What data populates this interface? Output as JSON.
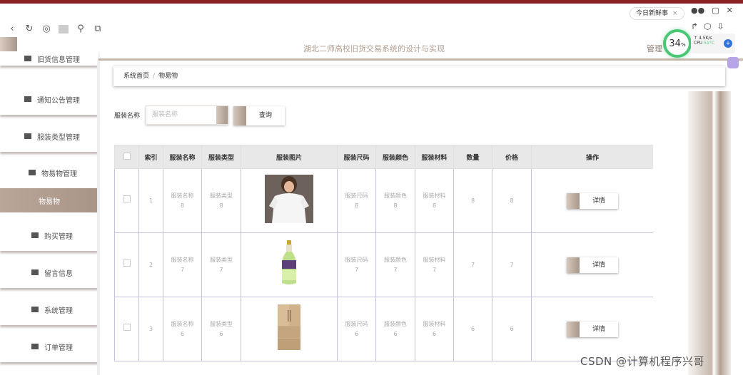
{
  "browser": {
    "tab_label": "今日新鲜事",
    "tab_close": "×",
    "window_controls": [
      "▢",
      "✕"
    ]
  },
  "cpu": {
    "percent": "34",
    "percent_unit": "%",
    "speed": "4.5K/s",
    "cpu_label": "CPU",
    "cpu_temp": "51°C"
  },
  "header": {
    "site_title": "湖北二师高校旧货交易系统的设计与实现",
    "admin_label": "管理"
  },
  "sidebar": {
    "items": [
      {
        "label": "旧货信息管理"
      },
      {
        "label": "通知公告管理"
      },
      {
        "label": "服装类型管理"
      },
      {
        "label": "物易物管理"
      },
      {
        "label": "物易物"
      },
      {
        "label": "购买管理"
      },
      {
        "label": "留言信息"
      },
      {
        "label": "系统管理"
      },
      {
        "label": "订单管理"
      }
    ]
  },
  "breadcrumb": {
    "home": "系统首页",
    "separator": "/",
    "current": "物易物"
  },
  "search": {
    "label": "服装名称",
    "placeholder": "服装名称",
    "button": "查询"
  },
  "table": {
    "headers": [
      "",
      "索引",
      "服装名称",
      "服装类型",
      "服装图片",
      "服装尺码",
      "服装颜色",
      "服装材料",
      "数量",
      "价格",
      "操作"
    ],
    "rows": [
      {
        "index": "1",
        "name": "服装名称",
        "name_num": "8",
        "type": "服装类型",
        "type_num": "8",
        "size": "服装尺码",
        "size_num": "8",
        "color": "服装颜色",
        "color_num": "8",
        "material": "服装材料",
        "material_num": "8",
        "qty": "8",
        "price": "8",
        "action": "详情",
        "image": "tshirt-photo"
      },
      {
        "index": "2",
        "name": "服装名称",
        "name_num": "7",
        "type": "服装类型",
        "type_num": "7",
        "size": "服装尺码",
        "size_num": "7",
        "color": "服装颜色",
        "color_num": "7",
        "material": "服装材料",
        "material_num": "7",
        "qty": "7",
        "price": "7",
        "action": "详情",
        "image": "bottle-photo"
      },
      {
        "index": "3",
        "name": "服装名称",
        "name_num": "6",
        "type": "服装类型",
        "type_num": "6",
        "size": "服装尺码",
        "size_num": "6",
        "color": "服装颜色",
        "color_num": "6",
        "material": "服装材料",
        "material_num": "6",
        "qty": "6",
        "price": "6",
        "action": "详情",
        "image": "fridge-photo"
      }
    ]
  },
  "watermark": "CSDN @计算机程序兴哥",
  "colors": {
    "accent": "#b9a699",
    "accent_dark": "#a8968a",
    "brand_red": "#8a1f24",
    "cpu_ring": "#48c774"
  }
}
